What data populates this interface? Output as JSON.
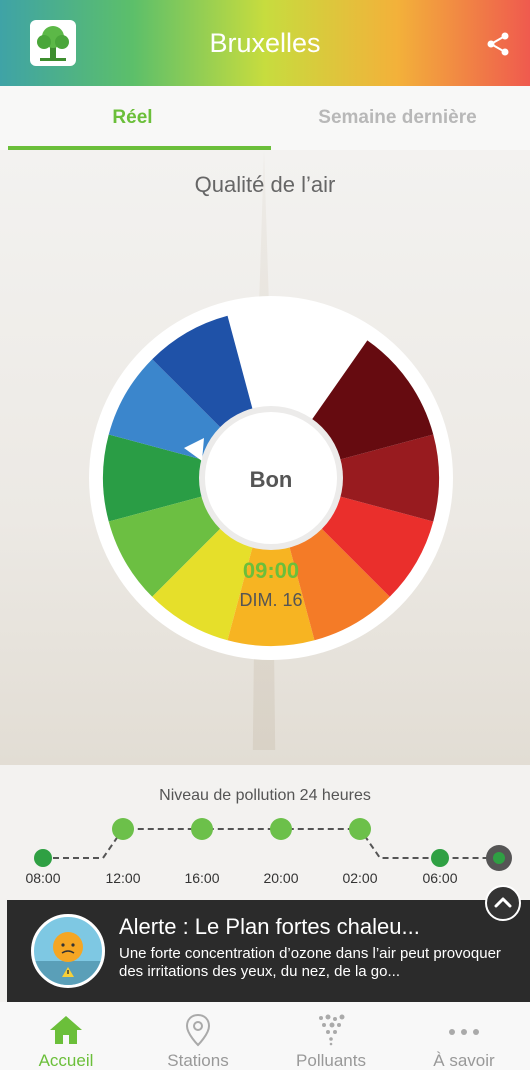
{
  "header": {
    "title": "Bruxelles",
    "logo_icon": "tree-icon",
    "share_icon": "share-icon",
    "gradient_colors": [
      "#3fa3a6",
      "#5cbf6a",
      "#c7dc3e",
      "#f3b13a",
      "#ef5a4e"
    ]
  },
  "tabs": [
    {
      "label": "Réel",
      "active": true
    },
    {
      "label": "Semaine dernière",
      "active": false
    }
  ],
  "air_quality": {
    "title": "Qualité de l’air",
    "level": "Bon",
    "time": "09:00",
    "date": "DIM. 16",
    "accent": "#6bbf3a",
    "scale_colors": [
      "#2a9d45",
      "#6cbf42",
      "#e6df2a",
      "#f7b422",
      "#f47b27",
      "#ea2f2c",
      "#981b1f",
      "#660b10",
      "#1f52a8",
      "#3b86cc"
    ]
  },
  "pollution": {
    "title": "Niveau de pollution 24 heures",
    "hours": [
      "08:00",
      "12:00",
      "16:00",
      "20:00",
      "02:00",
      "06:00"
    ]
  },
  "alert": {
    "title": "Alerte : Le Plan fortes chaleu...",
    "text": "Une forte concentration d’ozone dans l’air peut provoquer des irritations des yeux, du nez, de la go...",
    "icon": "sun-alert-icon"
  },
  "nav": [
    {
      "label": "Accueil",
      "icon": "home-icon",
      "active": true
    },
    {
      "label": "Stations",
      "icon": "location-pin-icon",
      "active": false
    },
    {
      "label": "Polluants",
      "icon": "particles-icon",
      "active": false
    },
    {
      "label": "À savoir",
      "icon": "more-dots-icon",
      "active": false
    }
  ]
}
